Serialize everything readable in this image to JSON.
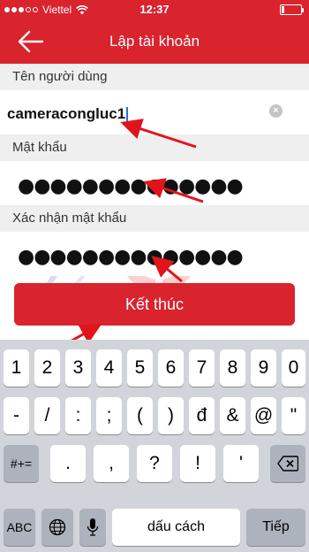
{
  "status_bar": {
    "carrier": "Viettel",
    "time": "12:37"
  },
  "nav": {
    "title": "Lập tài khoản"
  },
  "form": {
    "username_label": "Tên người dùng",
    "username_value": "cameracongluc1",
    "password_label": "Mật khẩu",
    "password_mask": "●●●●●●●●●●●●●●",
    "confirm_label": "Xác nhận mật khẩu",
    "confirm_mask": "●●●●●●●●●●●●●●"
  },
  "finish_button": {
    "label": "Kết thúc"
  },
  "keyboard": {
    "row1": [
      "1",
      "2",
      "3",
      "4",
      "5",
      "6",
      "7",
      "8",
      "9",
      "0"
    ],
    "row2": [
      "-",
      "/",
      ":",
      ";",
      "(",
      ")",
      "đ",
      "&",
      "@",
      "\""
    ],
    "row3_left": "#+=",
    "row3": [
      ".",
      ",",
      "?",
      "!",
      "'"
    ],
    "abc": "ABC",
    "space": "dấu cách",
    "next": "Tiếp"
  },
  "colors": {
    "brand_red": "#d9232d",
    "key_bg": "#ffffff",
    "keyboard_bg": "#d1d4da"
  },
  "icons": [
    "wifi-icon",
    "battery-icon",
    "back-arrow-icon",
    "clear-text-icon",
    "globe-icon",
    "microphone-icon",
    "backspace-icon"
  ]
}
